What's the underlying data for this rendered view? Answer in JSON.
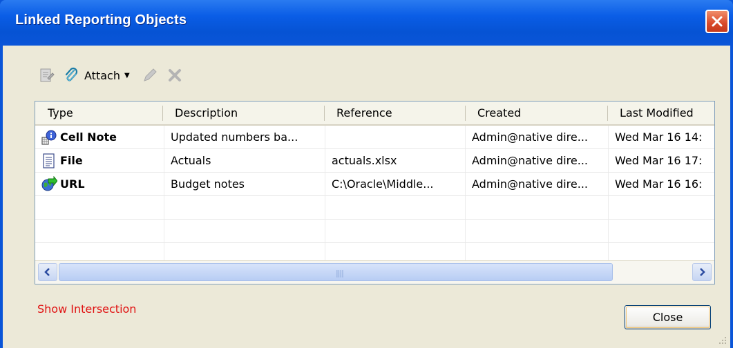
{
  "window": {
    "title": "Linked Reporting Objects"
  },
  "toolbar": {
    "attach_label": "Attach"
  },
  "table": {
    "columns": [
      "Type",
      "Description",
      "Reference",
      "Created",
      "Last Modified"
    ],
    "rows": [
      {
        "type": "Cell Note",
        "description": "Updated numbers ba...",
        "reference": "",
        "created": "Admin@native dire...",
        "modified": "Wed Mar 16 14:"
      },
      {
        "type": "File",
        "description": "Actuals",
        "reference": "actuals.xlsx",
        "created": "Admin@native dire...",
        "modified": "Wed Mar 16 17:"
      },
      {
        "type": "URL",
        "description": "Budget notes",
        "reference": "C:\\Oracle\\Middle...",
        "created": "Admin@native dire...",
        "modified": "Wed Mar 16 16:"
      }
    ]
  },
  "footer": {
    "show_intersection": "Show Intersection",
    "close_label": "Close"
  }
}
